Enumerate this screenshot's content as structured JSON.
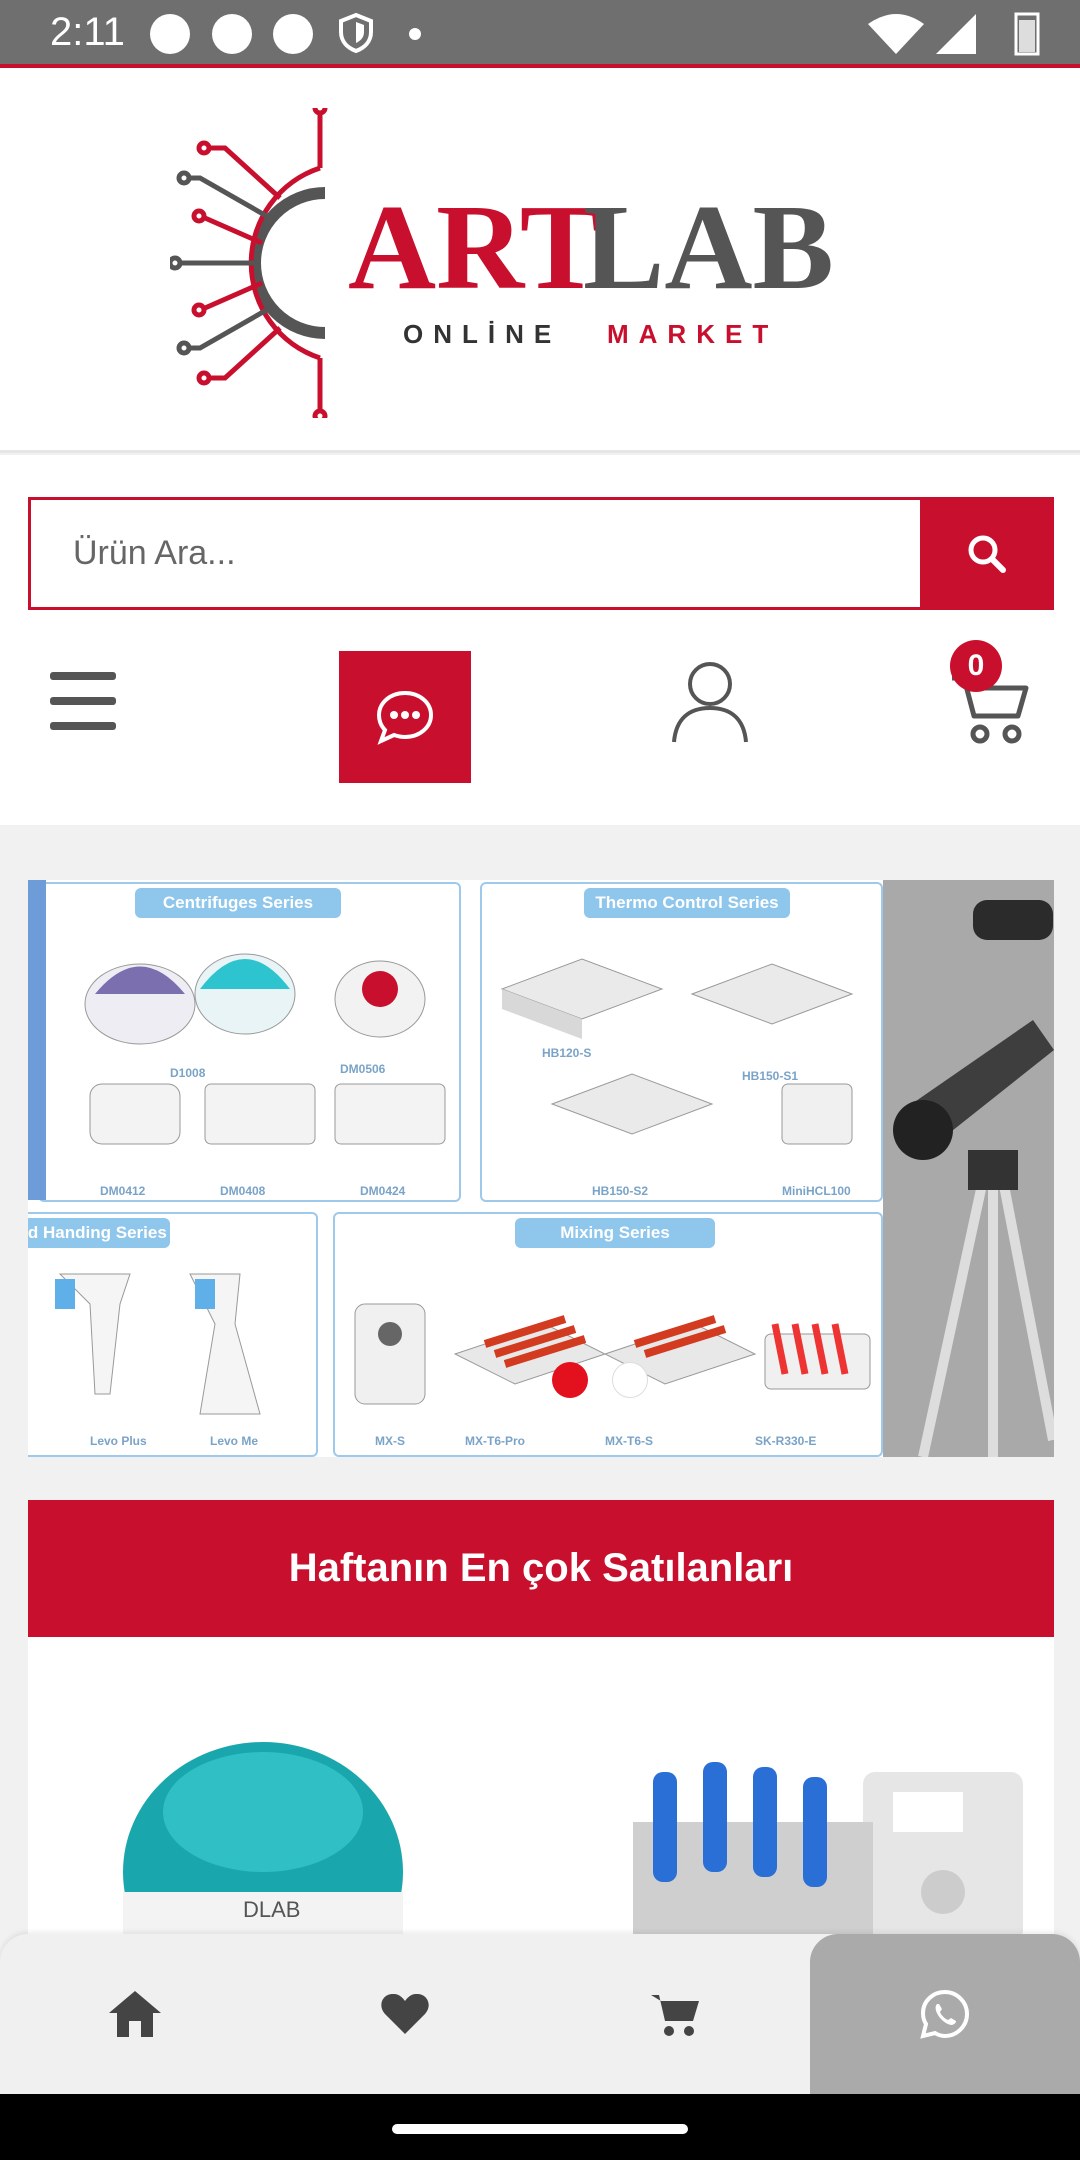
{
  "status_bar": {
    "time": "2:11"
  },
  "logo": {
    "brand_red": "ART",
    "brand_gray": "LAB",
    "tagline_gray": "ONLİNE",
    "tagline_red": "MARKET"
  },
  "search": {
    "placeholder": "Ürün Ara..."
  },
  "cart": {
    "count": "0"
  },
  "carousel": {
    "active_index": 0,
    "slide_count": 2,
    "panels": [
      {
        "title": "Centrifuges Series",
        "models": [
          "D1008",
          "DM0506",
          "DM0412",
          "DM0408",
          "DM0424"
        ]
      },
      {
        "title": "Thermo Control Series",
        "models": [
          "HB120-S",
          "HB150-S1",
          "HB150-S2",
          "MiniHCL100"
        ]
      },
      {
        "title": "id Handing Series",
        "models": [
          "Levo Plus",
          "Levo Me"
        ]
      },
      {
        "title": "Mixing Series",
        "models": [
          "MX-S",
          "MX-T6-Pro",
          "MX-T6-S",
          "SK-R330-E"
        ]
      }
    ]
  },
  "best_sellers": {
    "title": "Haftanın En çok Satılanları"
  },
  "colors": {
    "accent": "#c8102e",
    "gray": "#555555",
    "panel_blue": "#8fc6ec"
  },
  "icons": {
    "search": "search-icon",
    "menu": "hamburger-menu-icon",
    "chat": "chat-bubble-icon",
    "user": "user-icon",
    "cart": "cart-icon",
    "home": "home-icon",
    "favorites": "heart-icon",
    "whatsapp": "whatsapp-icon"
  }
}
